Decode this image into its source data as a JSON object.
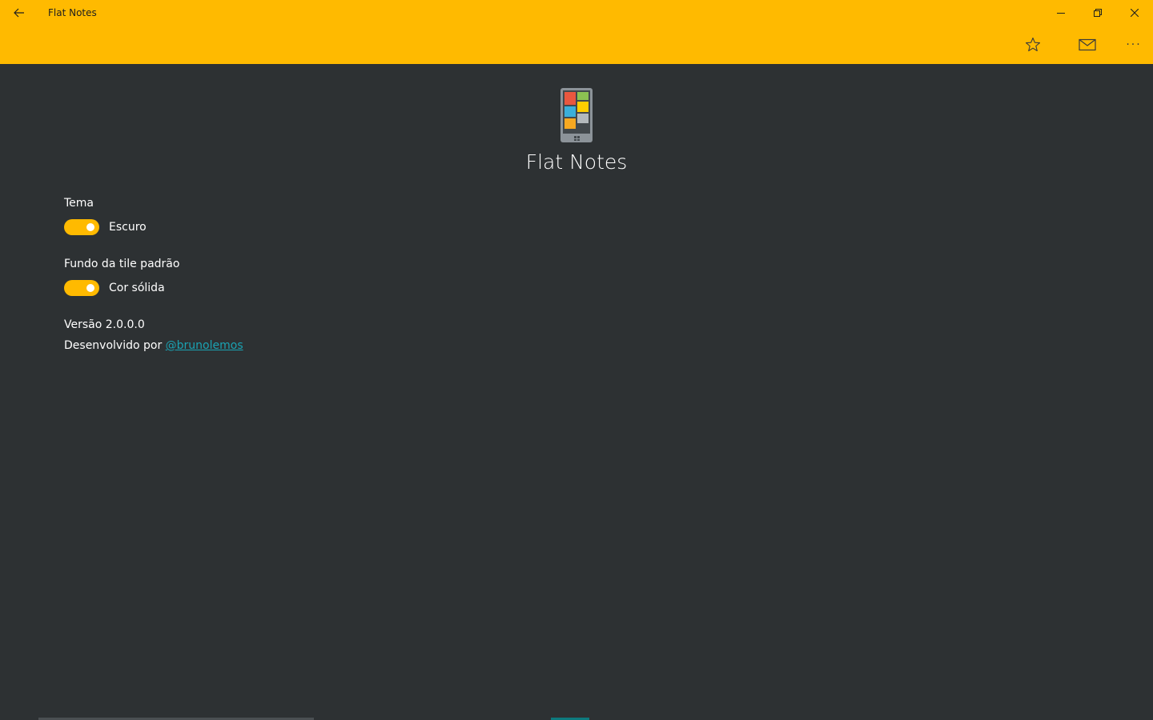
{
  "window": {
    "title": "Flat Notes"
  },
  "command_bar": {
    "more_label": "···"
  },
  "header": {
    "app_name": "Flat Notes"
  },
  "settings": {
    "theme": {
      "label": "Tema",
      "toggle_state": "on",
      "toggle_text": "Escuro"
    },
    "tile_background": {
      "label": "Fundo da tile padrão",
      "toggle_state": "on",
      "toggle_text": "Cor sólida"
    }
  },
  "about": {
    "version": "Versão 2.0.0.0",
    "developed_by": "Desenvolvido por ",
    "developer_link": "@brunolemos"
  },
  "colors": {
    "accent": "#ffba00",
    "background": "#2d3133",
    "link": "#1aa3b3"
  },
  "icons": {
    "back": "back-arrow-icon",
    "minimize": "minimize-icon",
    "maximize": "restore-icon",
    "close": "close-icon",
    "favorite": "star-icon",
    "mail": "mail-icon",
    "more": "more-icon"
  }
}
